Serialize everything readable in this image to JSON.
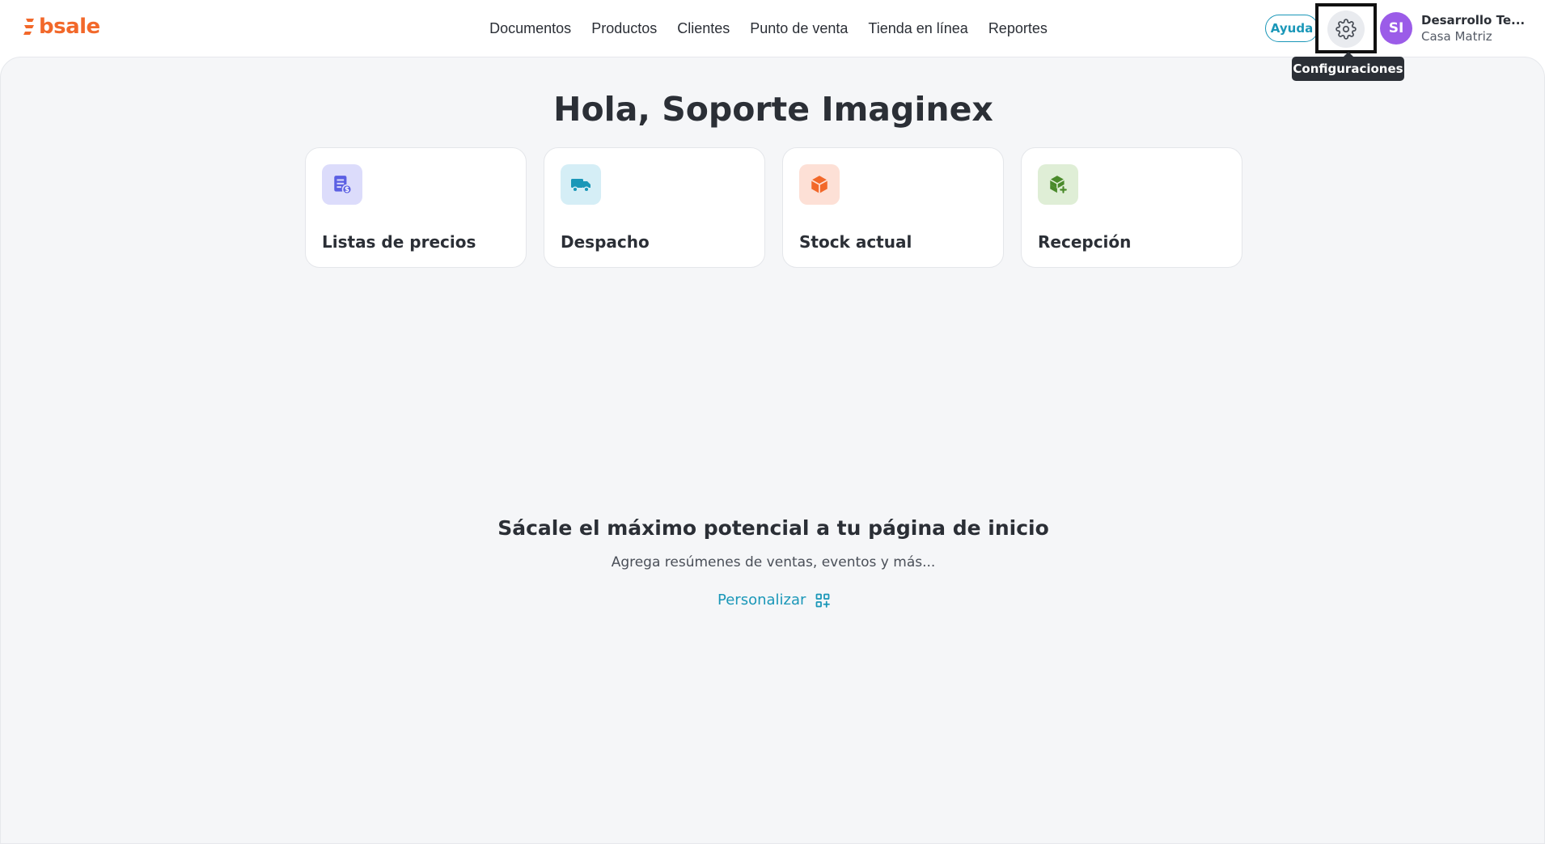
{
  "brand": {
    "name": "bsale",
    "color": "#f2682a"
  },
  "nav": {
    "items": [
      {
        "label": "Documentos"
      },
      {
        "label": "Productos"
      },
      {
        "label": "Clientes"
      },
      {
        "label": "Punto de venta"
      },
      {
        "label": "Tienda en línea"
      },
      {
        "label": "Reportes"
      }
    ]
  },
  "header": {
    "help_label": "Ayuda",
    "settings_icon": "gear-icon",
    "settings_tooltip": "Configuraciones",
    "user": {
      "initials": "SI",
      "name": "Desarrollo Te...",
      "branch": "Casa Matriz",
      "avatar_color": "#9b5ce8"
    }
  },
  "main": {
    "greeting": "Hola, Soporte Imaginex",
    "shortcuts": [
      {
        "label": "Listas de precios",
        "icon": "price-list-icon",
        "icon_bg": "#dcdcfb",
        "icon_color": "#5b5fe3"
      },
      {
        "label": "Despacho",
        "icon": "truck-icon",
        "icon_bg": "#d5eef6",
        "icon_color": "#1a97b8"
      },
      {
        "label": "Stock actual",
        "icon": "box-icon",
        "icon_bg": "#fde0d6",
        "icon_color": "#f2682a"
      },
      {
        "label": "Recepción",
        "icon": "box-add-icon",
        "icon_bg": "#dfeed6",
        "icon_color": "#4a8a2a"
      }
    ],
    "promo": {
      "title": "Sácale el máximo potencial a tu página de inicio",
      "subtitle": "Agrega resúmenes de ventas, eventos y más...",
      "action_label": "Personalizar",
      "action_icon": "widgets-add-icon",
      "accent": "#1a97b8"
    }
  }
}
